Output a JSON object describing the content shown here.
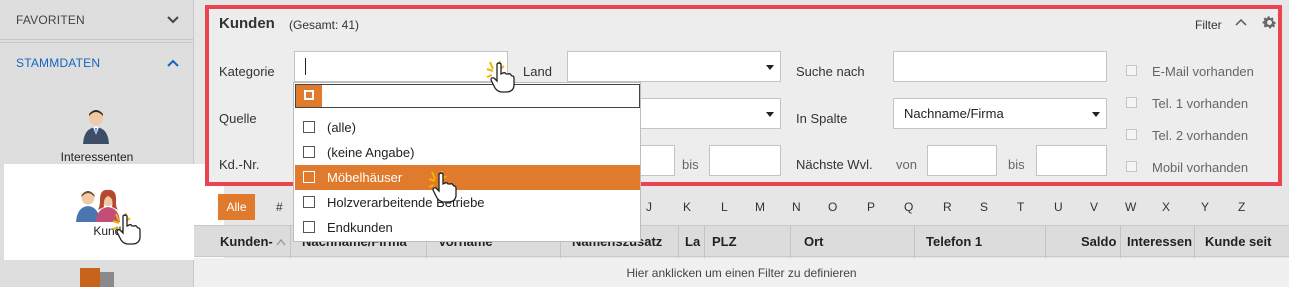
{
  "sidebar": {
    "favoriten": "FAVORITEN",
    "stammdaten": "STAMMDATEN",
    "interessenten": "Interessenten",
    "kunden": "Kunden"
  },
  "panel": {
    "title": "Kunden",
    "total": "(Gesamt: 41)",
    "filter": "Filter",
    "kategorie": "Kategorie",
    "land": "Land",
    "suche_nach": "Suche nach",
    "quelle": "Quelle",
    "in_spalte": "In Spalte",
    "in_spalte_value": "Nachname/Firma",
    "kdnr": "Kd.-Nr.",
    "bis1": "bis",
    "naechste_wvl": "Nächste Wvl.",
    "von": "von",
    "bis2": "bis",
    "checks": [
      "E-Mail vorhanden",
      "Tel. 1 vorhanden",
      "Tel. 2 vorhanden",
      "Mobil vorhanden"
    ]
  },
  "dropdown": {
    "items": [
      "(alle)",
      "(keine Angabe)",
      "Möbelhäuser",
      "Holzverarbeitende Betriebe",
      "Endkunden"
    ],
    "highlighted_index": 2
  },
  "alphabet": {
    "all": "Alle",
    "letters": [
      "#",
      "J",
      "K",
      "L",
      "M",
      "N",
      "O",
      "P",
      "Q",
      "R",
      "S",
      "T",
      "U",
      "V",
      "W",
      "X",
      "Y",
      "Z"
    ]
  },
  "table": {
    "columns": [
      "Kunden-",
      "Nachname/Firma",
      "Vorname",
      "Namenszusatz",
      "La",
      "PLZ",
      "Ort",
      "Telefon 1",
      "Saldo",
      "Interessen",
      "Kunde seit"
    ],
    "hint": "Hier anklicken um einen Filter zu definieren"
  },
  "colors": {
    "accent": "#e07a2d",
    "panel_border": "#e94450",
    "link_blue": "#1565c0"
  }
}
